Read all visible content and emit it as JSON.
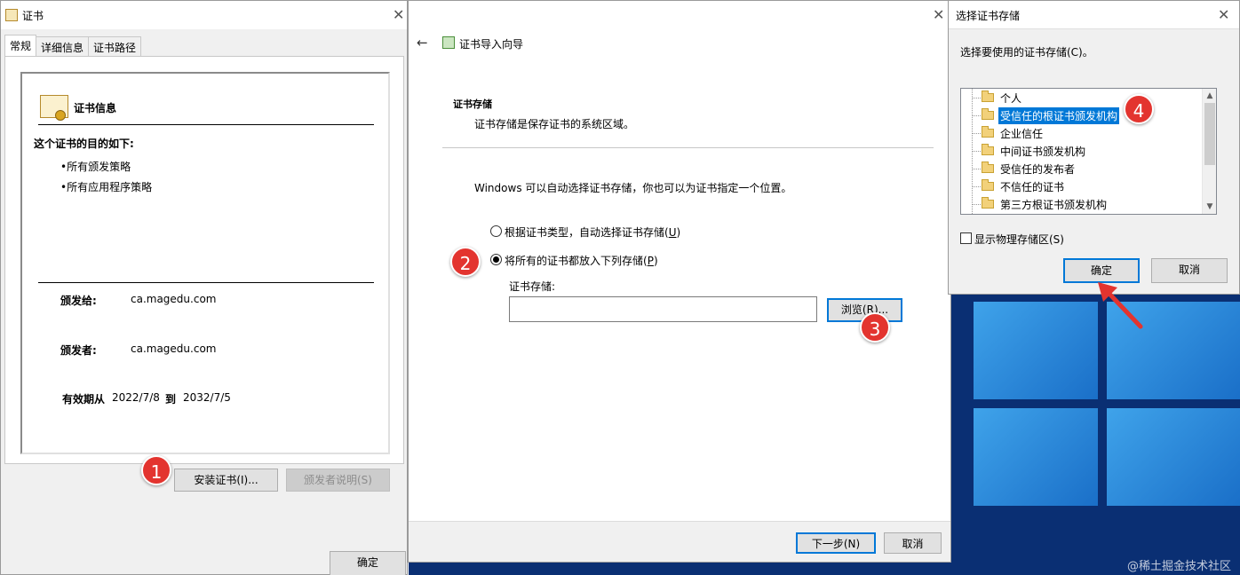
{
  "cert_window": {
    "title": "证书",
    "tabs": [
      "常规",
      "详细信息",
      "证书路径"
    ],
    "heading": "证书信息",
    "purpose_title": "这个证书的目的如下:",
    "purposes": [
      "•所有颁发策略",
      "•所有应用程序策略"
    ],
    "issued_to_label": "颁发给:",
    "issued_to_value": "ca.magedu.com",
    "issued_by_label": "颁发者:",
    "issued_by_value": "ca.magedu.com",
    "validity_label": "有效期从",
    "valid_from": "2022/7/8",
    "to_label": "到",
    "valid_to": "2032/7/5",
    "install_button": "安装证书(I)...",
    "issuer_statement_button": "颁发者说明(S)",
    "ok_button": "确定"
  },
  "wizard_window": {
    "title": "证书导入向导",
    "section_title": "证书存储",
    "section_desc": "证书存储是保存证书的系统区域。",
    "instruction": "Windows 可以自动选择证书存储，你也可以为证书指定一个位置。",
    "option_auto": "根据证书类型，自动选择证书存储(",
    "option_auto_key": "U",
    "option_manual": "将所有的证书都放入下列存储(",
    "option_manual_key": "P",
    "option_close": ")",
    "store_label": "证书存储:",
    "store_value": "",
    "browse_button": "浏览(R)...",
    "next_button": "下一步(N)",
    "cancel_button": "取消"
  },
  "store_window": {
    "title": "选择证书存储",
    "prompt": "选择要使用的证书存储(C)。",
    "stores": [
      "个人",
      "受信任的根证书颁发机构",
      "企业信任",
      "中间证书颁发机构",
      "受信任的发布者",
      "不信任的证书",
      "第三方根证书颁发机构"
    ],
    "selected_index": 1,
    "show_physical": "显示物理存储区(S)",
    "show_physical_checked": false,
    "ok_button": "确定",
    "cancel_button": "取消"
  },
  "callouts": [
    "1",
    "2",
    "3",
    "4"
  ],
  "watermark": "@稀土掘金技术社区",
  "colors": {
    "callout": "#e3342f",
    "selection": "#0078d7",
    "desktop": "#0a2f73"
  }
}
